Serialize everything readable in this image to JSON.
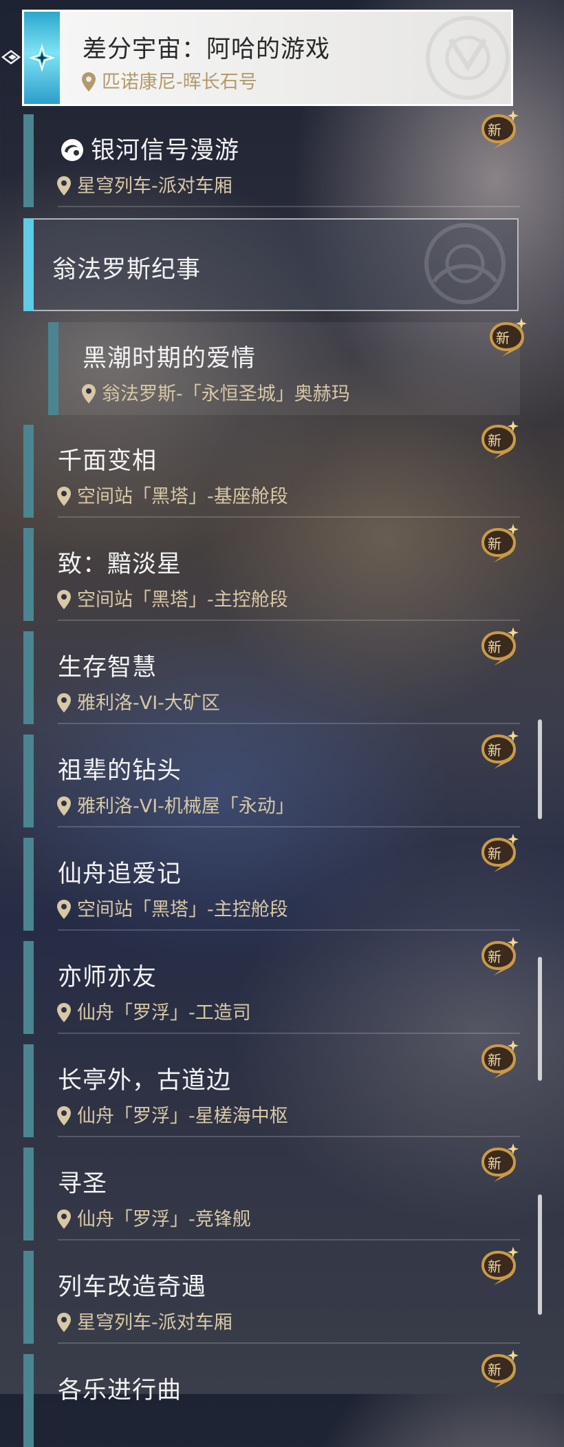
{
  "selected": {
    "title": "差分宇宙：阿哈的游戏",
    "location": "匹诺康尼-晖长石号"
  },
  "first_item": {
    "title": "银河信号漫游",
    "location": "星穹列车-派对车厢",
    "badge": "新"
  },
  "category": {
    "title": "翁法罗斯纪事"
  },
  "sub_item": {
    "title": "黑潮时期的爱情",
    "location": "翁法罗斯-「永恒圣城」奥赫玛",
    "badge": "新"
  },
  "items": [
    {
      "title": "千面变相",
      "location": "空间站「黑塔」-基座舱段",
      "badge": "新"
    },
    {
      "title": "致：黯淡星",
      "location": "空间站「黑塔」-主控舱段",
      "badge": "新"
    },
    {
      "title": "生存智慧",
      "location": "雅利洛-VI-大矿区",
      "badge": "新"
    },
    {
      "title": "祖辈的钻头",
      "location": "雅利洛-VI-机械屋「永动」",
      "badge": "新"
    },
    {
      "title": "仙舟追爱记",
      "location": "空间站「黑塔」-主控舱段",
      "badge": "新"
    },
    {
      "title": "亦师亦友",
      "location": "仙舟「罗浮」-工造司",
      "badge": "新"
    },
    {
      "title": "长亭外，古道边",
      "location": "仙舟「罗浮」-星槎海中枢",
      "badge": "新"
    },
    {
      "title": "寻圣",
      "location": "仙舟「罗浮」-竞锋舰",
      "badge": "新"
    },
    {
      "title": "列车改造奇遇",
      "location": "星穹列车-派对车厢",
      "badge": "新"
    },
    {
      "title": "各乐进行曲",
      "location": "",
      "badge": "新"
    }
  ]
}
